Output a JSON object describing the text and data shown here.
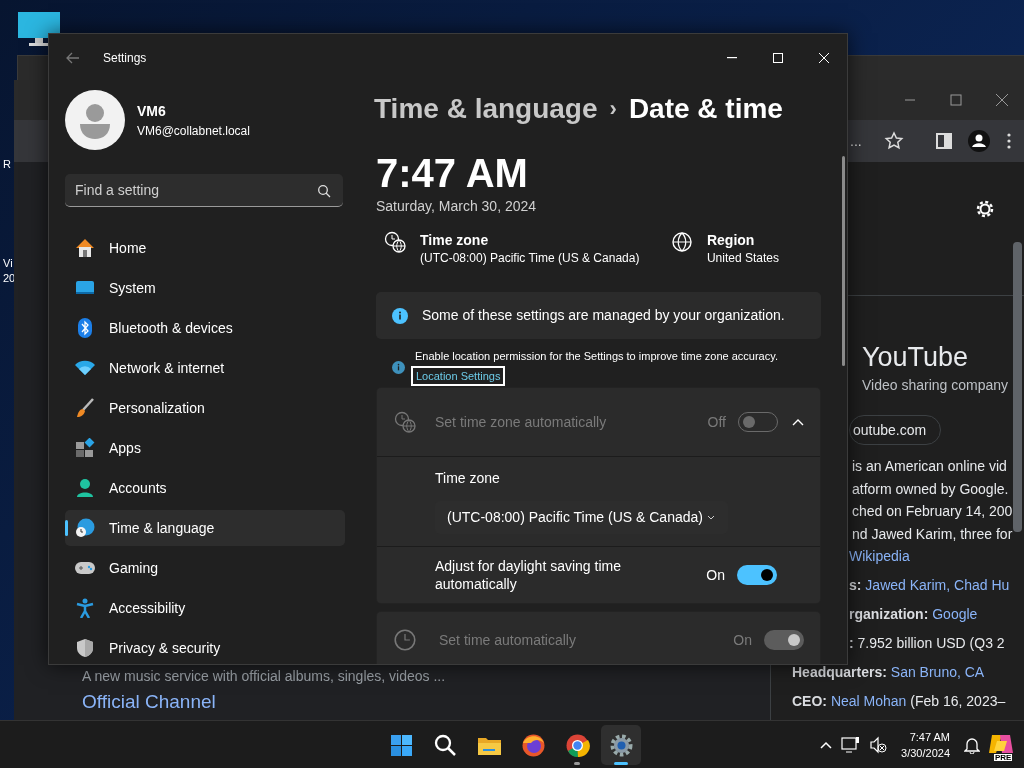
{
  "desktop": {
    "icon_labels": [
      {
        "text": "R"
      },
      {
        "text": "Vi"
      },
      {
        "text": "20"
      }
    ]
  },
  "browser": {
    "toolbar_text": "...",
    "panel": {
      "title": "YouTube",
      "subtitle": "Video sharing company",
      "site_chip": "outube.com",
      "description": [
        "is an American online vid",
        "atform owned by Google.",
        "ched on February 14, 200",
        "nd Jawed Karim, three for"
      ],
      "source_link": "Wikipedia",
      "facts": [
        {
          "label": "s:",
          "value": "Jawed Karim, Chad Hu",
          "kind": "link"
        },
        {
          "label": "rganization:",
          "value": "Google",
          "kind": "link"
        },
        {
          "label": ":",
          "value": "7.952 billion USD (Q3 2",
          "kind": "text"
        },
        {
          "label": "Headquarters:",
          "value": "San Bruno, CA",
          "kind": "link"
        },
        {
          "label": "CEO:",
          "value": "Neal Mohan",
          "note": "(Feb 16, 2023–",
          "kind": "link"
        }
      ]
    },
    "result": {
      "snippet": "A new music service with official albums, singles, videos ...",
      "link": "Official Channel"
    }
  },
  "settings": {
    "title": "Settings",
    "user": {
      "name": "VM6",
      "email": "VM6@collabnet.local"
    },
    "search": {
      "placeholder": "Find a setting"
    },
    "nav": [
      {
        "label": "Home",
        "selected": false
      },
      {
        "label": "System",
        "selected": false
      },
      {
        "label": "Bluetooth & devices",
        "selected": false
      },
      {
        "label": "Network & internet",
        "selected": false
      },
      {
        "label": "Personalization",
        "selected": false
      },
      {
        "label": "Apps",
        "selected": false
      },
      {
        "label": "Accounts",
        "selected": false
      },
      {
        "label": "Time & language",
        "selected": true
      },
      {
        "label": "Gaming",
        "selected": false
      },
      {
        "label": "Accessibility",
        "selected": false
      },
      {
        "label": "Privacy & security",
        "selected": false
      }
    ],
    "breadcrumb": {
      "parent": "Time & language",
      "separator": "›",
      "current": "Date & time"
    },
    "clock": {
      "time": "7:47 AM",
      "date": "Saturday, March 30, 2024"
    },
    "summary": [
      {
        "label": "Time zone",
        "value": "(UTC-08:00) Pacific Time (US & Canada)"
      },
      {
        "label": "Region",
        "value": "United States"
      }
    ],
    "notice": "Some of these settings are managed by your organization.",
    "location_hint": {
      "text": "Enable location permission for the Settings to improve time zone accuracy.",
      "link": "Location Settings",
      "focused": true
    },
    "rows": [
      {
        "kind": "expander",
        "label": "Set time zone automatically",
        "disabled": true,
        "state_text": "Off",
        "on": false,
        "expanded": true,
        "children": [
          {
            "kind": "dropdown",
            "label": "Time zone",
            "value": "(UTC-08:00) Pacific Time (US & Canada)"
          },
          {
            "kind": "toggle",
            "label": "Adjust for daylight saving time automatically",
            "disabled": false,
            "state_text": "On",
            "on": true
          }
        ]
      },
      {
        "kind": "toggle",
        "label": "Set time automatically",
        "disabled": true,
        "state_text": "On",
        "on": true
      }
    ]
  },
  "taskbar": {
    "apps": [
      {
        "selected": false,
        "running": false
      },
      {
        "selected": false,
        "running": false
      },
      {
        "selected": false,
        "running": false
      },
      {
        "selected": false,
        "running": false
      },
      {
        "selected": false,
        "running": true
      },
      {
        "selected": true,
        "running": true
      }
    ],
    "clock": {
      "time": "7:47 AM",
      "date": "3/30/2024"
    },
    "badge": "PRE"
  }
}
